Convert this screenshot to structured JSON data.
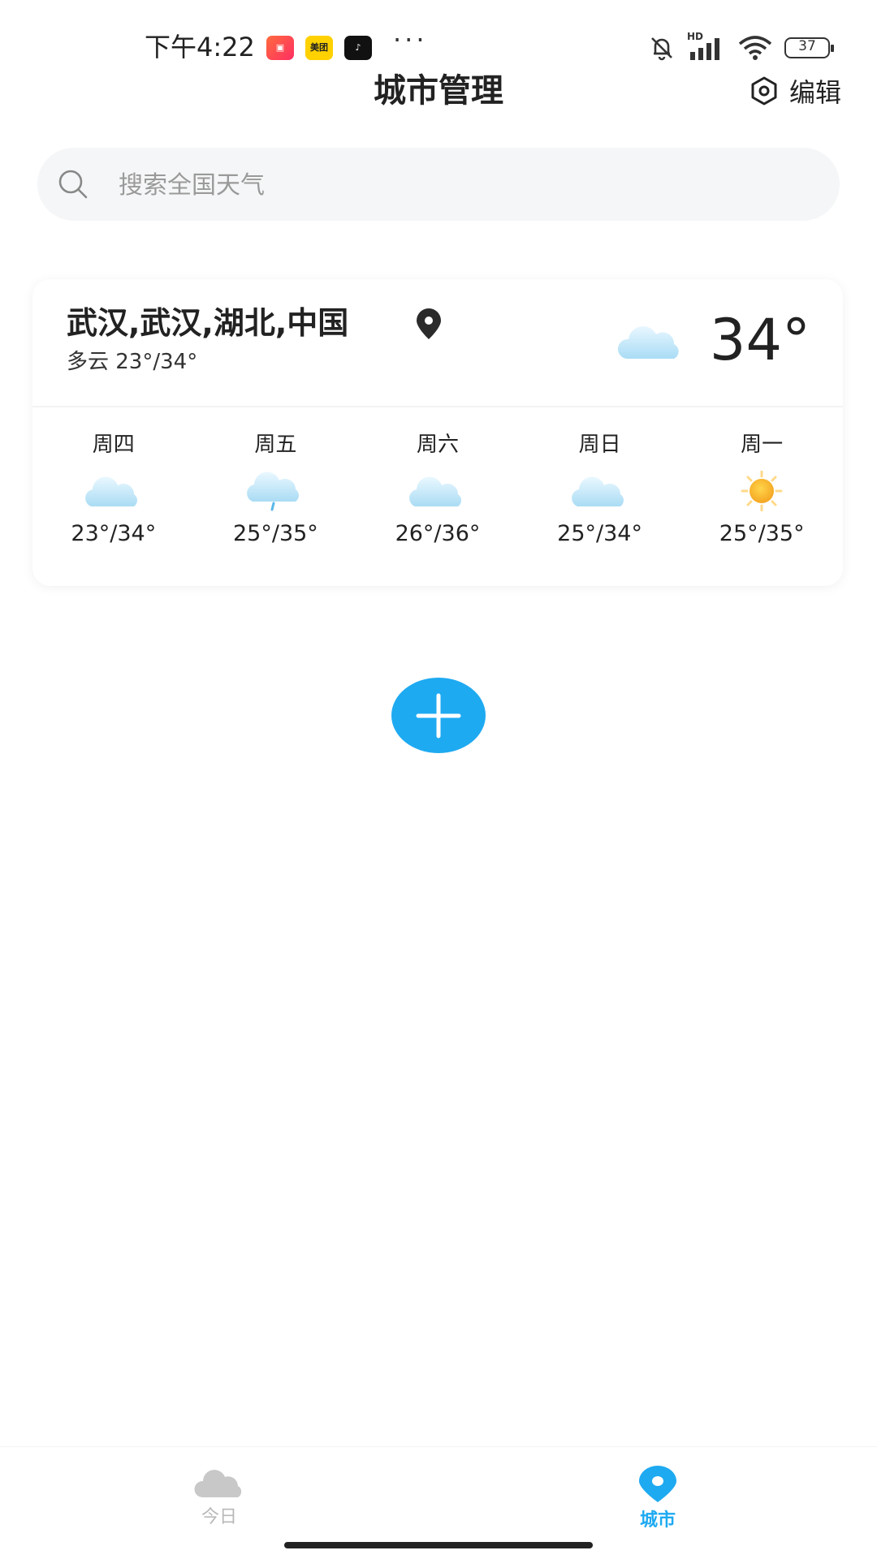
{
  "status_bar": {
    "time": "下午4:22",
    "apps": [
      "app-icon-1",
      "美团",
      "douyin-icon"
    ],
    "more": "···",
    "signal_label": "HD",
    "battery": "37"
  },
  "header": {
    "title": "城市管理",
    "edit_label": "编辑"
  },
  "search": {
    "placeholder": "搜索全国天气",
    "value": ""
  },
  "city_card": {
    "name": "武汉,武汉,湖北,中国",
    "summary": "多云 23°/34°",
    "current_temp": "34°",
    "current_icon": "cloud-icon",
    "forecast": [
      {
        "day": "周四",
        "icon": "cloud-icon",
        "temp": "23°/34°"
      },
      {
        "day": "周五",
        "icon": "rain-cloud-icon",
        "temp": "25°/35°"
      },
      {
        "day": "周六",
        "icon": "cloud-icon",
        "temp": "26°/36°"
      },
      {
        "day": "周日",
        "icon": "cloud-icon",
        "temp": "25°/34°"
      },
      {
        "day": "周一",
        "icon": "sun-icon",
        "temp": "25°/35°"
      }
    ]
  },
  "bottom_nav": {
    "items": [
      {
        "label": "今日",
        "icon": "cloud-icon",
        "active": false
      },
      {
        "label": "城市",
        "icon": "location-pin-icon",
        "active": true
      }
    ]
  },
  "colors": {
    "accent": "#1eaaf1",
    "text": "#222222",
    "muted": "#9a9a9a"
  }
}
